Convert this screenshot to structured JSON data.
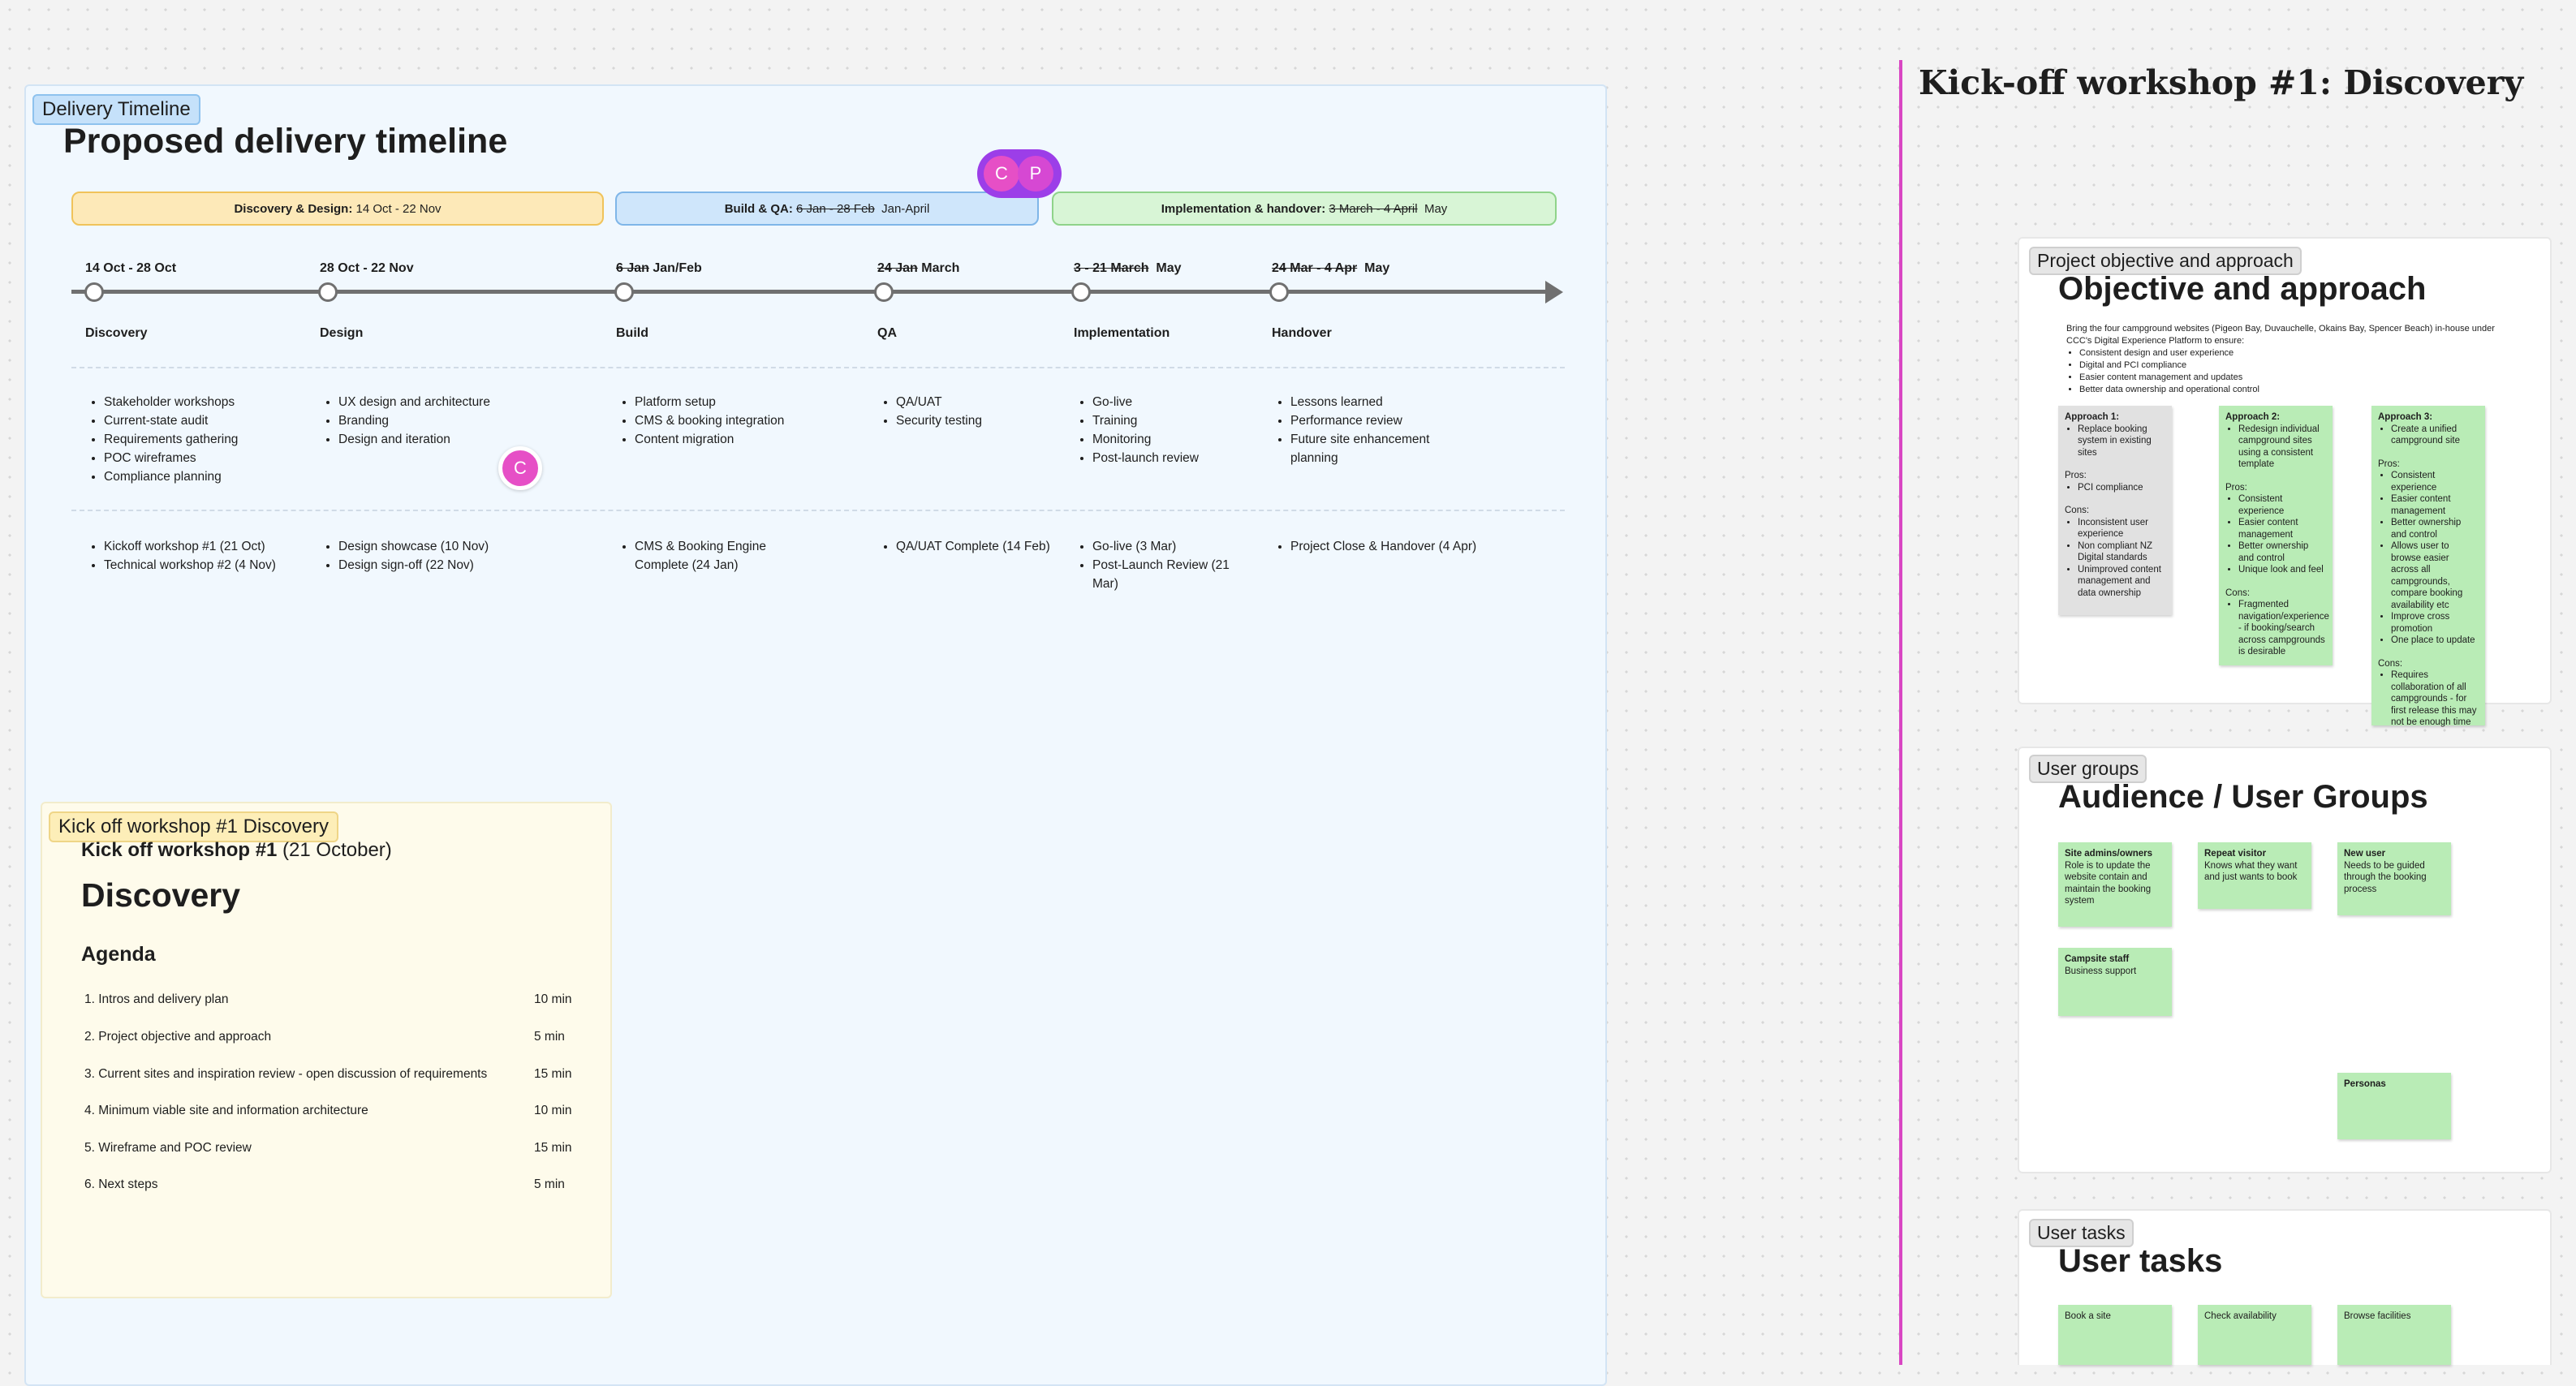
{
  "timeline": {
    "tag": "Delivery Timeline",
    "title": "Proposed delivery timeline",
    "phases": [
      {
        "bold": "Discovery & Design:",
        "text": " 14 Oct - 22 Nov",
        "struck": "",
        "after": ""
      },
      {
        "bold": "Build & QA:",
        "text": " ",
        "struck": "6 Jan - 28 Feb",
        "after": "  Jan-April"
      },
      {
        "bold": "Implementation & handover:",
        "text": " ",
        "struck": "3 March - 4 April",
        "after": "  May"
      }
    ],
    "stages": [
      {
        "date_struck": "",
        "date": "14 Oct - 28 Oct",
        "name": "Discovery",
        "activities": [
          "Stakeholder workshops",
          "Current-state audit",
          "Requirements gathering",
          "POC wireframes",
          "Compliance planning"
        ],
        "milestones": [
          "Kickoff workshop #1 (21 Oct)",
          "Technical workshop #2 (4 Nov)"
        ]
      },
      {
        "date_struck": "",
        "date": "28 Oct - 22 Nov",
        "name": "Design",
        "activities": [
          "UX design and architecture",
          "Branding",
          "Design and iteration"
        ],
        "milestones": [
          "Design showcase (10 Nov)",
          "Design sign-off (22 Nov)"
        ]
      },
      {
        "date_struck": "6 Jan",
        "date": " Jan/Feb",
        "name": "Build",
        "activities": [
          "Platform setup",
          "CMS & booking integration",
          "Content migration"
        ],
        "milestones": [
          "CMS & Booking Engine Complete (24 Jan)"
        ]
      },
      {
        "date_struck": "24 Jan",
        "date": " March",
        "name": "QA",
        "activities": [
          "QA/UAT",
          "Security testing"
        ],
        "milestones": [
          "QA/UAT Complete (14 Feb)"
        ]
      },
      {
        "date_struck": "3 - 21 March",
        "date": "  May",
        "name": "Implementation",
        "activities": [
          "Go-live",
          "Training",
          "Monitoring",
          "Post-launch review"
        ],
        "milestones": [
          "Go-live (3 Mar)",
          "Post-Launch Review (21 Mar)"
        ]
      },
      {
        "date_struck": "24 Mar - 4 Apr",
        "date": "  May",
        "name": "Handover",
        "activities": [
          "Lessons learned",
          "Performance review",
          "Future site enhancement planning"
        ],
        "milestones": [
          "Project Close & Handover (4 Apr)"
        ]
      }
    ],
    "avatars": {
      "c1": "C",
      "p": "P",
      "c2": "C"
    }
  },
  "kickoff": {
    "tag": "Kick off workshop #1  Discovery",
    "heading_bold": "Kick off workshop #1",
    "heading_rest": " (21 October)",
    "title": "Discovery",
    "agenda_label": "Agenda",
    "agenda": [
      {
        "item": "1.  Intros and delivery plan",
        "duration": "10 min"
      },
      {
        "item": "2.  Project objective and approach",
        "duration": "5 min"
      },
      {
        "item": "3.  Current sites and inspiration review - open discussion of requirements",
        "duration": "15 min"
      },
      {
        "item": "4.  Minimum viable site and information architecture",
        "duration": "10 min"
      },
      {
        "item": "5.  Wireframe and POC review",
        "duration": "15 min"
      },
      {
        "item": "6.  Next steps",
        "duration": "5 min"
      }
    ]
  },
  "workshop": {
    "heading": "Kick-off workshop #1: Discovery",
    "objective": {
      "tag": "Project objective and approach",
      "title": "Objective and approach",
      "intro": "Bring the four campground websites (Pigeon Bay, Duvauchelle, Okains Bay, Spencer Beach) in-house under CCC's Digital Experience Platform to ensure:",
      "intro_points": [
        "Consistent design and user experience",
        "Digital and PCI compliance",
        "Easier content management and updates",
        "Better data ownership and operational control"
      ],
      "approaches": [
        {
          "title": "Approach 1:",
          "points": [
            "Replace booking system in existing sites"
          ],
          "pros_label": "Pros:",
          "pros": [
            "PCI compliance"
          ],
          "cons_label": "Cons:",
          "cons": [
            "Inconsistent user experience",
            "Non compliant NZ Digital standards",
            "Unimproved content management and data ownership"
          ]
        },
        {
          "title": "Approach 2:",
          "points": [
            "Redesign individual campground sites using a consistent template"
          ],
          "pros_label": "Pros:",
          "pros": [
            "Consistent experience",
            "Easier content management",
            "Better ownership and control",
            "Unique look and feel"
          ],
          "cons_label": "Cons:",
          "cons": [
            "Fragmented navigation/experience - if booking/search across campgrounds is desirable"
          ]
        },
        {
          "title": "Approach 3:",
          "points": [
            "Create a unified campground site"
          ],
          "pros_label": "Pros:",
          "pros": [
            "Consistent experience",
            "Easier content management",
            "Better ownership and control",
            "Allows user to browse easier across all campgrounds, compare booking availability etc",
            "Improve cross promotion",
            "One place to update"
          ],
          "cons_label": "Cons:",
          "cons": [
            "Requires collaboration of all campgrounds - for first release this may not be enough time"
          ]
        }
      ]
    },
    "user_groups": {
      "tag": "User groups",
      "title": "Audience / User Groups",
      "notes": [
        {
          "title": "Site admins/owners",
          "text": "Role is to update the website contain and maintain the booking system"
        },
        {
          "title": "Repeat visitor",
          "text": "Knows what they want and just wants to book"
        },
        {
          "title": "New user",
          "text": "Needs to be guided through the booking process"
        },
        {
          "title": "Campsite staff",
          "text": "Business support"
        },
        {
          "title": "Personas",
          "text": ""
        }
      ]
    },
    "user_tasks": {
      "tag": "User tasks",
      "title": "User tasks",
      "notes": [
        "Book a site",
        "Check availability",
        "Browse facilities"
      ]
    }
  },
  "colors": {
    "phase1_fill": "#fde9b8",
    "phase1_border": "#f0c35a",
    "phase2_fill": "#cfe6fb",
    "phase2_border": "#7fb6e8",
    "phase3_fill": "#d8f5d6",
    "phase3_border": "#8fd38a",
    "sticky_green": "#b9ecb6",
    "sticky_grey": "#e1e1e1",
    "avatar_pink": "#e64fc6",
    "avatar_purple": "#9c3ee8",
    "divider_pink": "#d946c3"
  }
}
